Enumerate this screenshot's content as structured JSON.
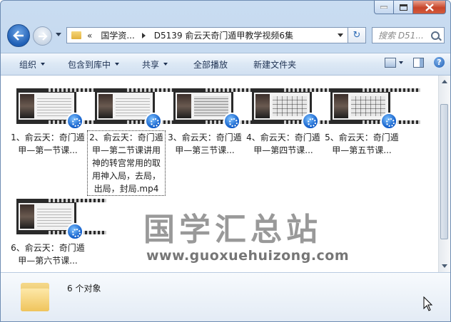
{
  "window": {
    "caption_buttons": [
      "minimize-icon",
      "maximize-icon",
      "close-icon"
    ]
  },
  "address": {
    "chevron": "«",
    "segments": [
      "国学资...",
      "D5139 俞云天奇门遁甲教学视频6集"
    ],
    "search_placeholder": "搜索 D51...",
    "refresh_icon": "↻"
  },
  "toolbar": {
    "organize": "组织",
    "include_in_library": "包含到库中",
    "share": "共享",
    "play_all": "全部播放",
    "new_folder": "新建文件夹",
    "help": "?"
  },
  "files": [
    {
      "label": "1、俞云天：奇门遁甲—第一节课...",
      "thumb": "text"
    },
    {
      "label": "2、俞云天：奇门遁甲—第二节课讲用神的转宫常用的取用神入局，去局，出局，封局.mp4",
      "thumb": "text",
      "selected": true
    },
    {
      "label": "3、俞云天：奇门遁甲—第三节课...",
      "thumb": "dark"
    },
    {
      "label": "4、俞云天：奇门遁甲—第四节课...",
      "thumb": "table"
    },
    {
      "label": "5、俞云天：奇门遁甲—第五节课...",
      "thumb": "table"
    },
    {
      "label": "6、俞云天：奇门遁甲—第六节课...",
      "thumb": "text"
    }
  ],
  "watermark": {
    "cn": "国学汇总站",
    "url": "www.guoxuehuizong.com"
  },
  "details": {
    "count": "6 个对象"
  }
}
